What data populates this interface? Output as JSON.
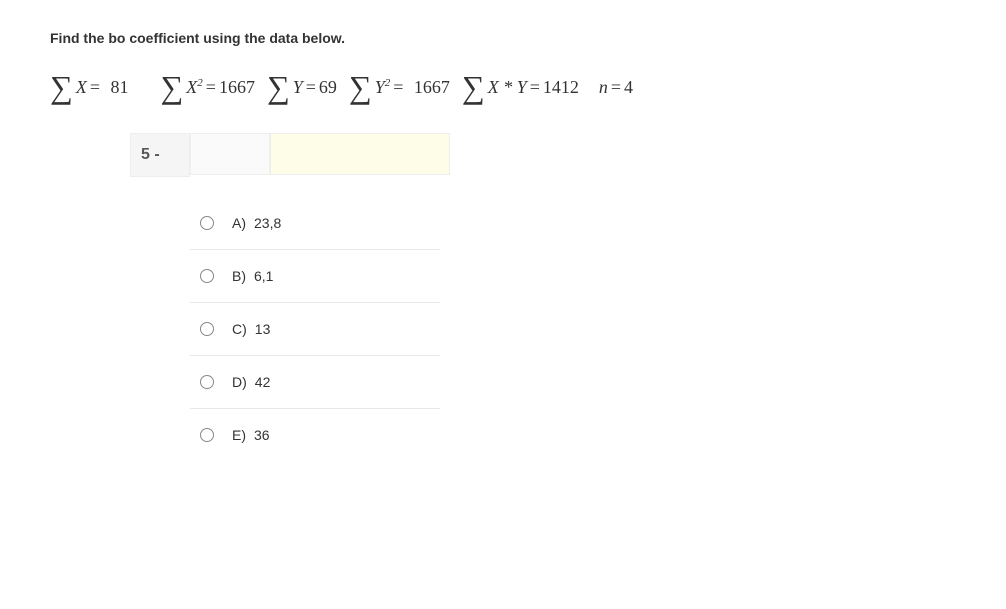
{
  "question": {
    "title": "Find the bo coefficient using the data below.",
    "number": "5 -",
    "header_note": "",
    "highlight_placeholder": ""
  },
  "equations": {
    "sum_x": {
      "var": "X",
      "op": "=",
      "val": "81"
    },
    "sum_x2": {
      "var": "X",
      "sup": "2",
      "op": "=",
      "val": "1667"
    },
    "sum_y": {
      "var": "Y",
      "op": "=",
      "val": "69"
    },
    "sum_y2": {
      "var": "Y",
      "sup": "2",
      "op": "=",
      "val": "1667"
    },
    "sum_xy": {
      "var": "X * Y",
      "op": "=",
      "val": "1412"
    },
    "n": {
      "var": "n",
      "op": "=",
      "val": "4"
    }
  },
  "options": [
    {
      "letter": "A)",
      "value": "23,8"
    },
    {
      "letter": "B)",
      "value": "6,1"
    },
    {
      "letter": "C)",
      "value": "13"
    },
    {
      "letter": "D)",
      "value": "42"
    },
    {
      "letter": "E)",
      "value": "36"
    }
  ]
}
